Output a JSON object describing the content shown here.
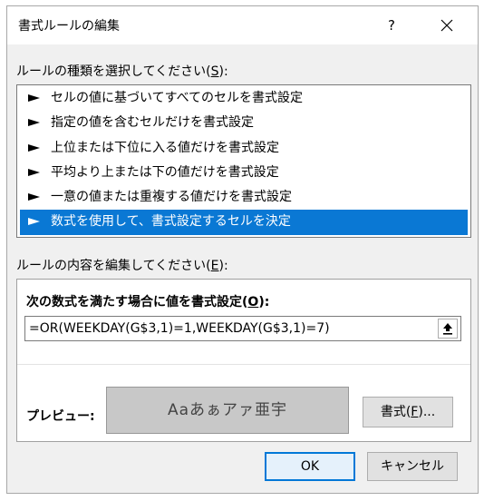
{
  "window": {
    "title": "書式ルールの編集",
    "help_label": "?"
  },
  "rule_type_section": {
    "label": "ルールの種類を選択してください(",
    "accel": "S",
    "suffix": "):",
    "items": [
      {
        "label": "セルの値に基づいてすべてのセルを書式設定"
      },
      {
        "label": "指定の値を含むセルだけを書式設定"
      },
      {
        "label": "上位または下位に入る値だけを書式設定"
      },
      {
        "label": "平均より上または下の値だけを書式設定"
      },
      {
        "label": "一意の値または重複する値だけを書式設定"
      },
      {
        "label": "数式を使用して、書式設定するセルを決定"
      }
    ],
    "selected_index": 5
  },
  "rule_content_section": {
    "label": "ルールの内容を編集してください(",
    "accel": "E",
    "suffix": "):",
    "formula_label": "次の数式を満たす場合に値を書式設定(",
    "formula_accel": "O",
    "formula_suffix": "):",
    "formula_value": "=OR(WEEKDAY(G$3,1)=1,WEEKDAY(G$3,1)=7)",
    "preview_label": "プレビュー:",
    "preview_text": "Aaあぁアァ亜宇",
    "format_button_label": "書式(",
    "format_button_accel": "F",
    "format_button_suffix": ")..."
  },
  "footer": {
    "ok_label": "OK",
    "cancel_label": "キャンセル"
  },
  "colors": {
    "selection": "#0a78d4",
    "ok_border": "#0078d7",
    "dialog_bg": "#f0f0f0"
  }
}
